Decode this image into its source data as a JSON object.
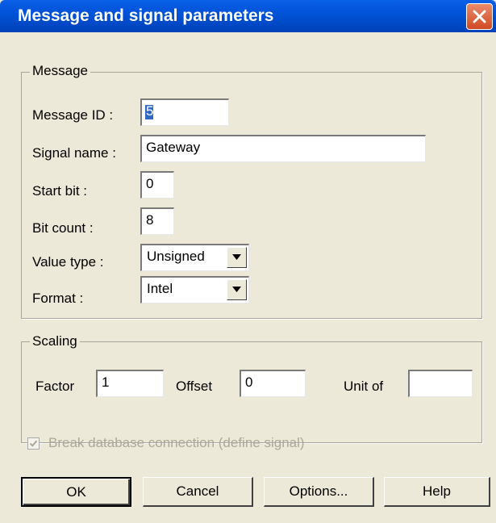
{
  "window": {
    "title": "Message and signal parameters"
  },
  "message_group": {
    "legend": "Message",
    "message_id": {
      "label": "Message ID :",
      "value": "5"
    },
    "signal_name": {
      "label": "Signal name :",
      "value": "Gateway"
    },
    "start_bit": {
      "label": "Start bit :",
      "value": "0"
    },
    "bit_count": {
      "label": "Bit count :",
      "value": "8"
    },
    "value_type": {
      "label": "Value type :",
      "selected": "Unsigned"
    },
    "format": {
      "label": "Format :",
      "selected": "Intel"
    }
  },
  "scaling_group": {
    "legend": "Scaling",
    "factor": {
      "label": "Factor",
      "value": "1"
    },
    "offset": {
      "label": "Offset",
      "value": "0"
    },
    "unit": {
      "label": "Unit of",
      "value": ""
    }
  },
  "break_connection": {
    "label": "Break database connection (define signal)",
    "checked": true,
    "disabled": true
  },
  "buttons": {
    "ok": "OK",
    "cancel": "Cancel",
    "options": "Options...",
    "help": "Help"
  },
  "colors": {
    "title_bar": "#0052d6",
    "face": "#ece9d8",
    "close_button": "#d14a23",
    "selection": "#316ac5"
  },
  "icons": {
    "close": "close-x-icon",
    "dropdown": "chevron-down-icon",
    "check": "checkmark-icon"
  }
}
